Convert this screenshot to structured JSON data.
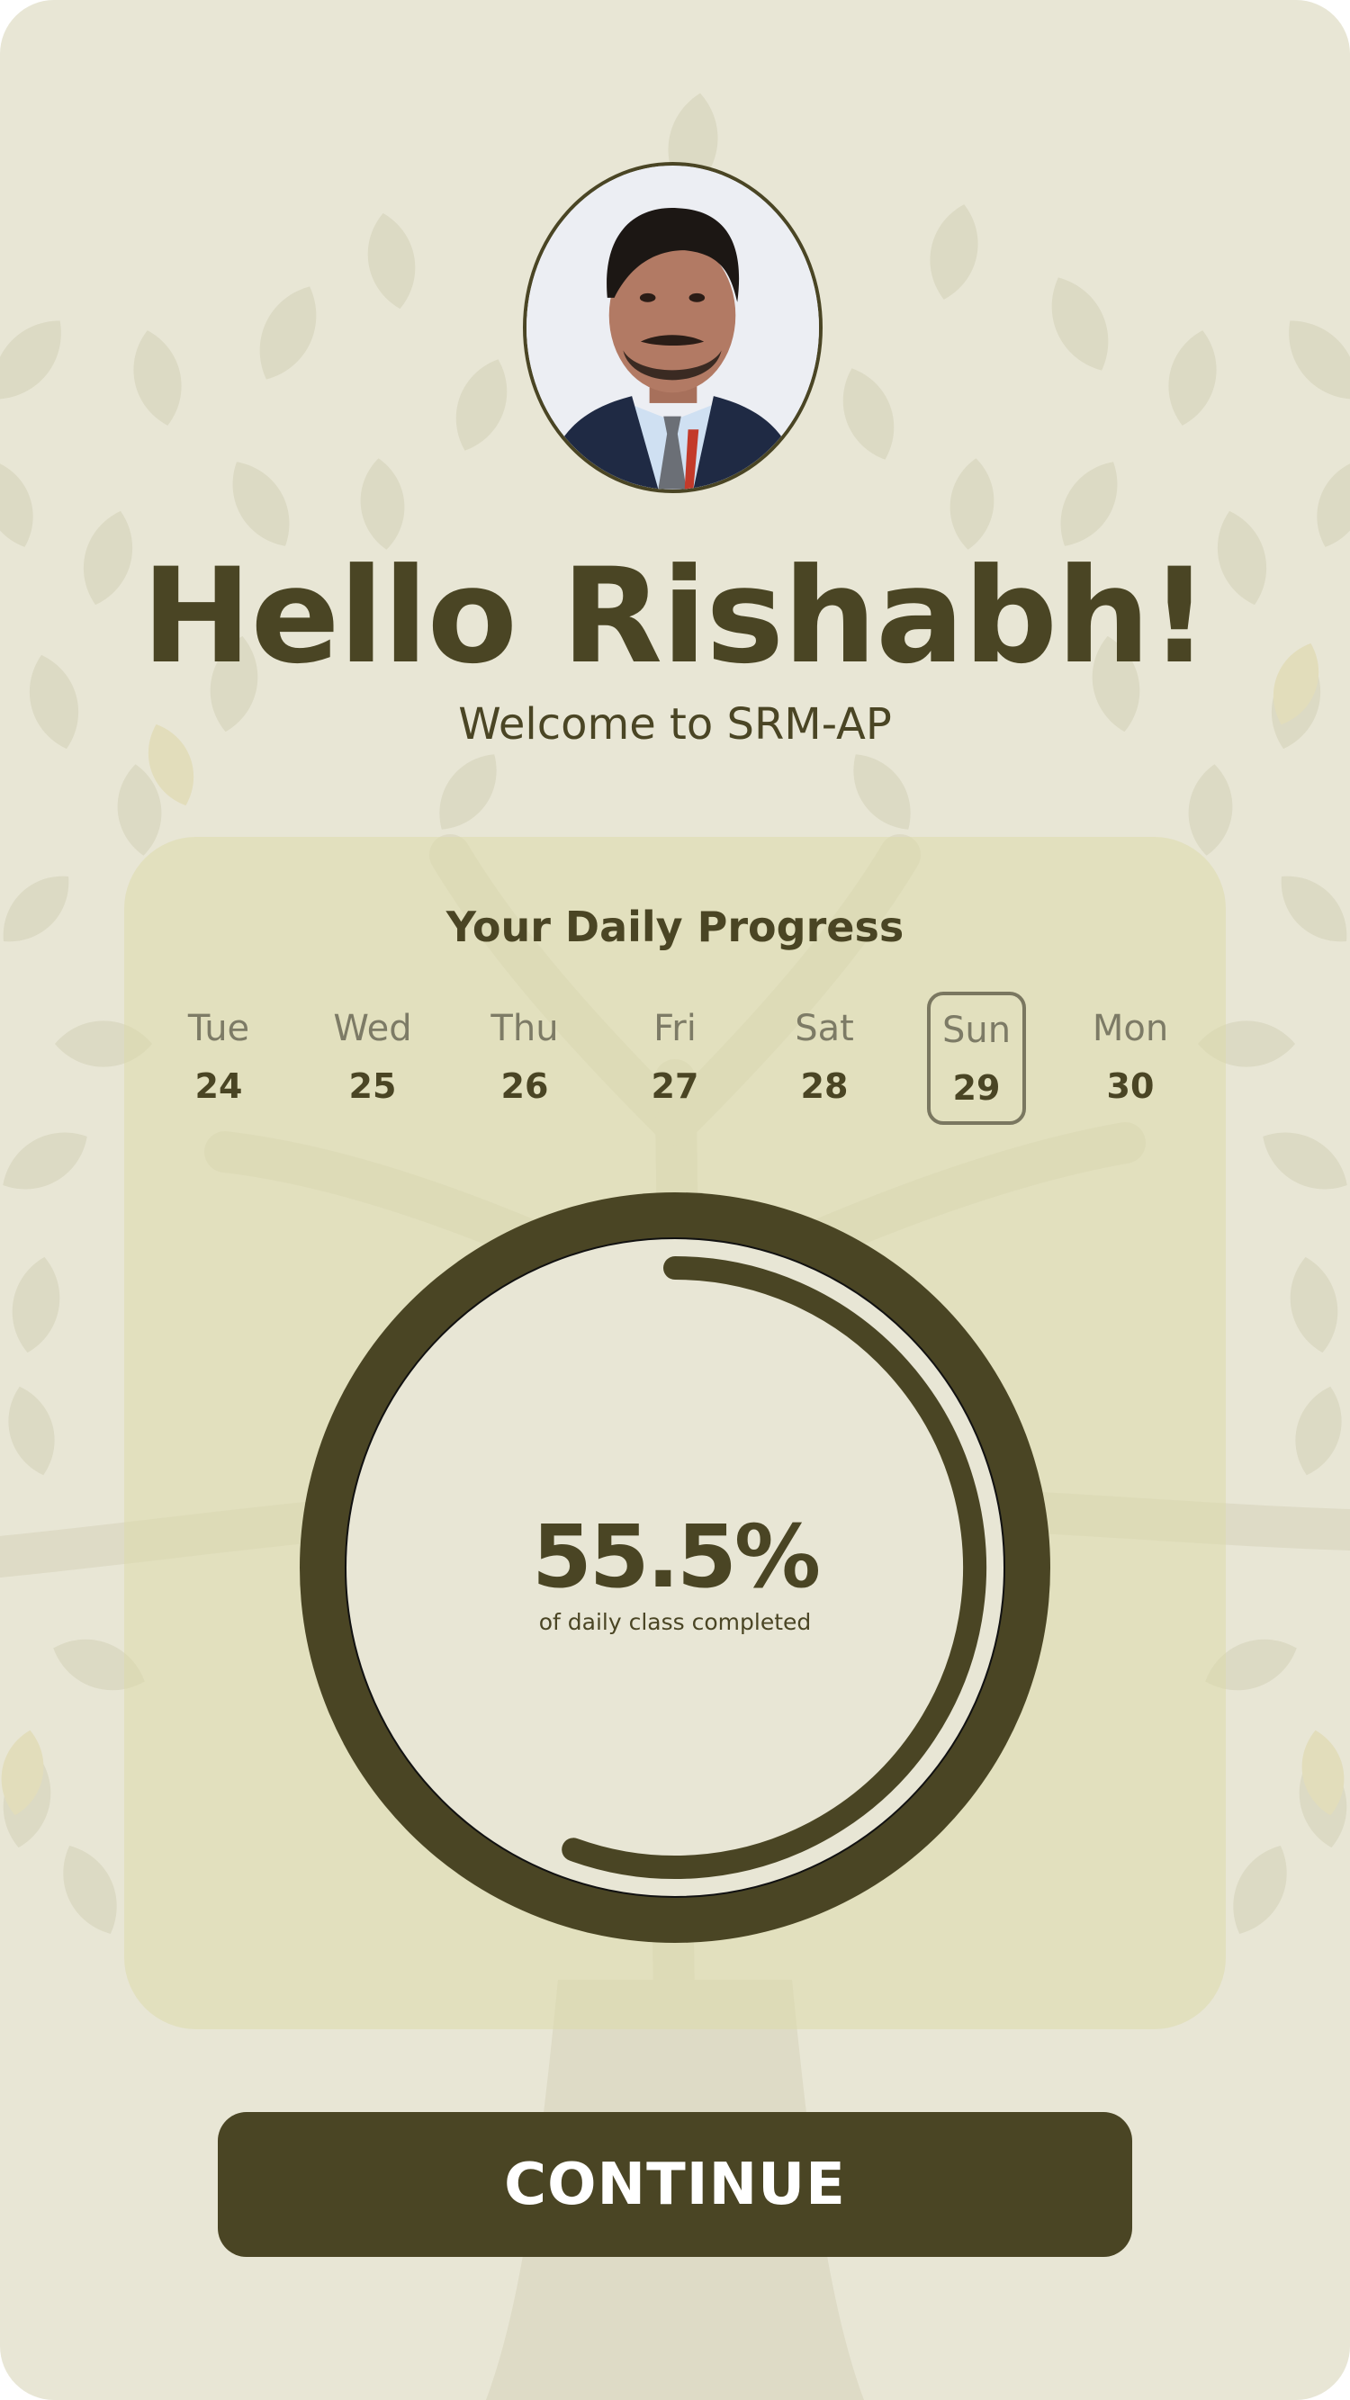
{
  "greeting": "Hello Rishabh!",
  "welcome": "Welcome to SRM-AP",
  "progress_card": {
    "title": "Your Daily Progress",
    "days": [
      {
        "name": "Tue",
        "date": "24",
        "selected": false
      },
      {
        "name": "Wed",
        "date": "25",
        "selected": false
      },
      {
        "name": "Thu",
        "date": "26",
        "selected": false
      },
      {
        "name": "Fri",
        "date": "27",
        "selected": false
      },
      {
        "name": "Sat",
        "date": "28",
        "selected": false
      },
      {
        "name": "Sun",
        "date": "29",
        "selected": true
      },
      {
        "name": "Mon",
        "date": "30",
        "selected": false
      }
    ],
    "percent": "55.5%",
    "percent_value": 55.5,
    "caption": "of daily class completed"
  },
  "continue_label": "CONTINUE",
  "colors": {
    "background": "#e8e6d5",
    "primary": "#4a4524",
    "card": "#dddbac",
    "muted_text": "#7d7b66"
  },
  "icons": {
    "avatar": "user-photo",
    "background": "tree-pattern"
  }
}
